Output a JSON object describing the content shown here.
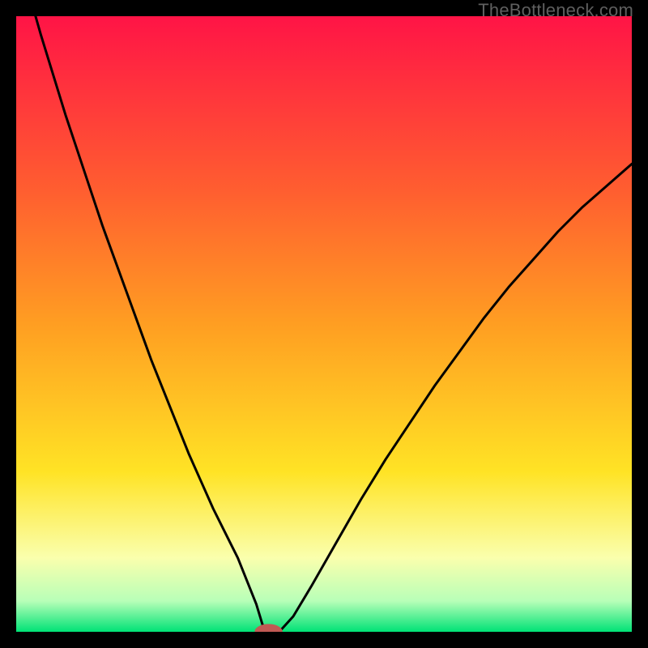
{
  "watermark": "TheBottleneck.com",
  "colors": {
    "frame": "#000000",
    "gradient_top": "#ff1446",
    "gradient_upper": "#ff5d30",
    "gradient_mid": "#ff9e22",
    "gradient_lower": "#ffe325",
    "gradient_pale": "#faffad",
    "gradient_green_pale": "#b8ffb8",
    "gradient_green": "#00e276",
    "curve": "#000000",
    "marker_fill": "#c15a54",
    "marker_stroke": "#c15a54"
  },
  "chart_data": {
    "type": "line",
    "title": "",
    "xlabel": "",
    "ylabel": "",
    "xlim": [
      0,
      100
    ],
    "ylim": [
      0,
      100
    ],
    "annotations": [],
    "marker": {
      "x": 41,
      "y": 0,
      "rx": 2.2,
      "ry": 1.2
    },
    "series": [
      {
        "name": "bottleneck-curve",
        "x": [
          0,
          2,
          4,
          6,
          8,
          10,
          12,
          14,
          16,
          18,
          20,
          22,
          24,
          26,
          28,
          30,
          32,
          34,
          36,
          38,
          39,
          40,
          41,
          42,
          43,
          45,
          48,
          52,
          56,
          60,
          64,
          68,
          72,
          76,
          80,
          84,
          88,
          92,
          96,
          100
        ],
        "y": [
          111,
          104,
          97,
          90.5,
          84,
          78,
          72,
          66,
          60.5,
          55,
          49.5,
          44,
          39,
          34,
          29,
          24.5,
          20,
          16,
          12,
          7,
          4.5,
          1.2,
          0,
          0,
          0.3,
          2.5,
          7.5,
          14.5,
          21.5,
          28,
          34,
          40,
          45.5,
          51,
          56,
          60.5,
          65,
          69,
          72.5,
          76
        ]
      }
    ]
  }
}
